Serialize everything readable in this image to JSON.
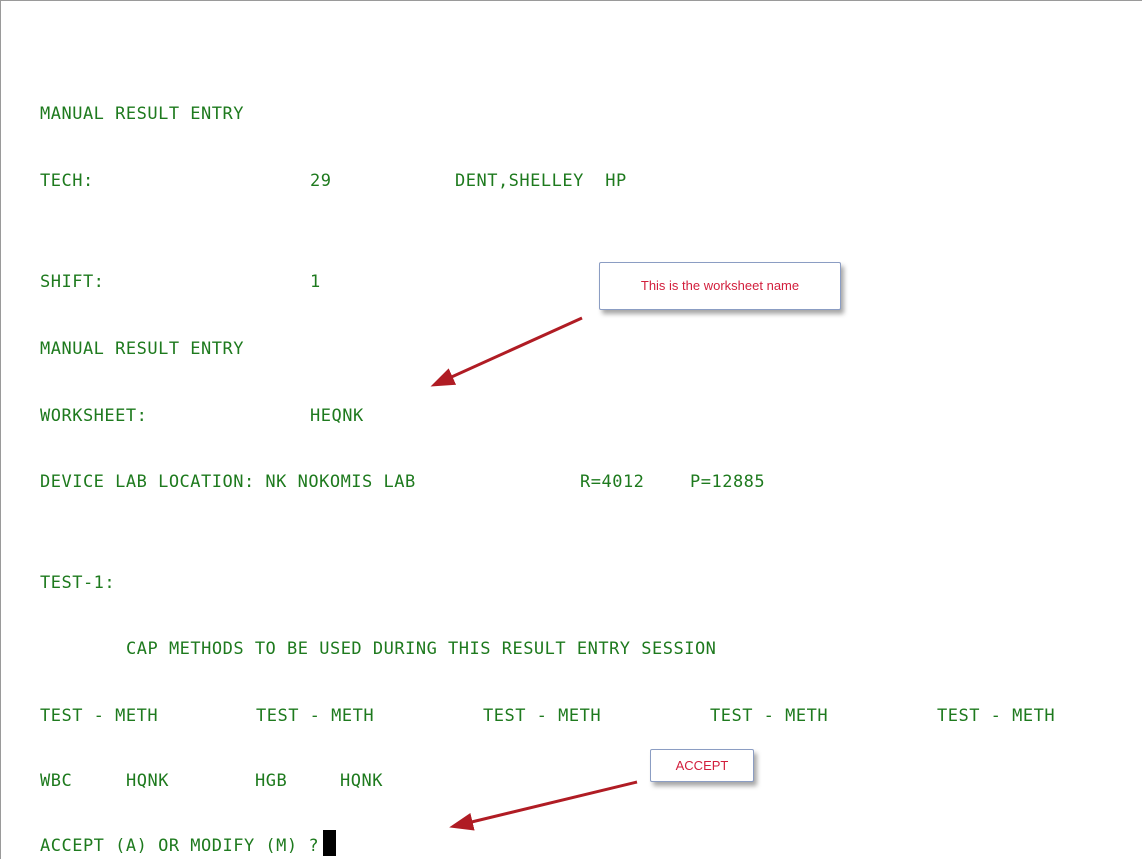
{
  "terminal": {
    "title1": "MANUAL RESULT ENTRY",
    "tech_label": "TECH:",
    "tech_number": "29",
    "tech_name": "DENT,SHELLEY  HP",
    "shift_label": "SHIFT:",
    "shift_value": "1",
    "title2": "MANUAL RESULT ENTRY",
    "worksheet_label": "WORKSHEET:",
    "worksheet_value": "HEQNK",
    "device_location": "DEVICE LAB LOCATION: NK NOKOMIS LAB",
    "r_value": "R=4012",
    "p_value": "P=12885",
    "test_label": "TEST-1:",
    "cap_methods_heading": "CAP METHODS TO BE USED DURING THIS RESULT ENTRY SESSION",
    "column_headers": [
      "TEST - METH",
      "TEST - METH",
      "TEST - METH",
      "TEST - METH",
      "TEST - METH"
    ],
    "methods": [
      {
        "test": "WBC",
        "meth": "HQNK"
      },
      {
        "test": "HGB",
        "meth": "HQNK"
      }
    ],
    "prompt": "ACCEPT (A) OR MODIFY (M) ?"
  },
  "annotations": {
    "worksheet_callout": "This is the worksheet name",
    "accept_callout": "ACCEPT",
    "callout_text_color": "#d21e3c",
    "arrow_color": "#b01c24",
    "terminal_text_color": "#1e7a1e"
  }
}
